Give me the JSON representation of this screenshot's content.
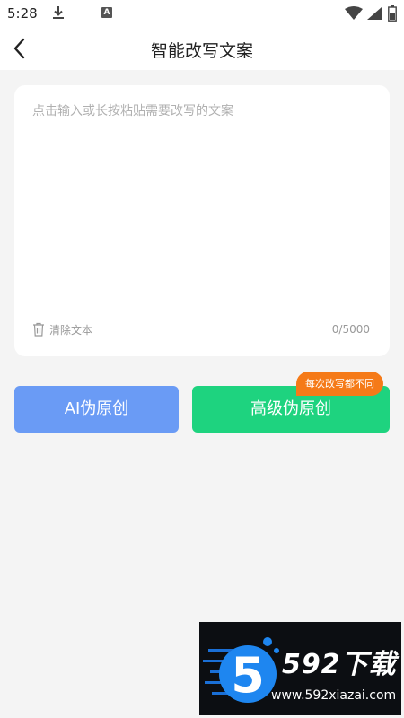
{
  "status_bar": {
    "time": "5:28",
    "icons": [
      "download-icon",
      "a-icon",
      "wifi-icon",
      "signal-icon",
      "battery-icon"
    ],
    "a_letter": "A"
  },
  "header": {
    "title": "智能改写文案",
    "back_icon": "back-arrow-icon"
  },
  "editor": {
    "placeholder": "点击输入或长按粘贴需要改写的文案",
    "value": "",
    "clear_label": "清除文本",
    "char_count": "0/5000"
  },
  "actions": {
    "ai_label": "AI伪原创",
    "advanced_label": "高级伪原创",
    "advanced_badge": "每次改写都不同"
  },
  "colors": {
    "ai_button": "#6a9bf5",
    "advanced_button": "#1ed37f",
    "badge": "#f57a18",
    "background": "#f4f4f4"
  },
  "watermark": {
    "title": "592下载",
    "url": "www.592xiazai.com",
    "logo_digit": "5"
  }
}
